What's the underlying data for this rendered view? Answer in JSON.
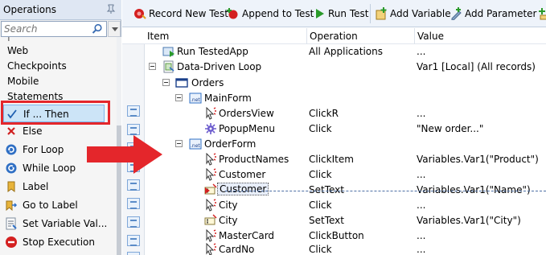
{
  "operations_panel": {
    "title": "Operations",
    "search_placeholder": "Search",
    "categories": [
      "Web",
      "Checkpoints",
      "Mobile",
      "Statements"
    ],
    "items": [
      {
        "label": "If ... Then",
        "icon": "check-icon",
        "selected": true
      },
      {
        "label": "Else",
        "icon": "else-icon"
      },
      {
        "label": "For Loop",
        "icon": "for-loop-icon"
      },
      {
        "label": "While Loop",
        "icon": "while-loop-icon"
      },
      {
        "label": "Label",
        "icon": "label-icon"
      },
      {
        "label": "Go to Label",
        "icon": "go-to-label-icon"
      },
      {
        "label": "Set Variable Val...",
        "icon": "set-variable-icon"
      },
      {
        "label": "Stop Execution",
        "icon": "stop-icon"
      }
    ]
  },
  "toolbar": {
    "record_new_test": "Record New Test",
    "append_to_test": "Append to Test",
    "run_test": "Run Test",
    "add_variable": "Add Variable",
    "add_parameter": "Add Parameter"
  },
  "grid": {
    "columns": {
      "item": "Item",
      "operation": "Operation",
      "value": "Value"
    },
    "rows": [
      {
        "item": "Run TestedApp",
        "operation": "All Applications",
        "value": "..."
      },
      {
        "item": "Data-Driven Loop",
        "operation": "",
        "value": "Var1 [Local] (All records)"
      },
      {
        "item": "Orders",
        "operation": "",
        "value": ""
      },
      {
        "item": "MainForm",
        "operation": "",
        "value": ""
      },
      {
        "item": "OrdersView",
        "operation": "ClickR",
        "value": "..."
      },
      {
        "item": "PopupMenu",
        "operation": "Click",
        "value": "\"New order...\""
      },
      {
        "item": "OrderForm",
        "operation": "",
        "value": ""
      },
      {
        "item": "ProductNames",
        "operation": "ClickItem",
        "value": "Variables.Var1(\"Product\")"
      },
      {
        "item": "Customer",
        "operation": "Click",
        "value": "..."
      },
      {
        "item": "Customer",
        "operation": "SetText",
        "value": "Variables.Var1(\"Name\")"
      },
      {
        "item": "City",
        "operation": "Click",
        "value": "..."
      },
      {
        "item": "City",
        "operation": "SetText",
        "value": "Variables.Var1(\"City\")"
      },
      {
        "item": "MasterCard",
        "operation": "ClickButton",
        "value": "..."
      },
      {
        "item": "CardNo",
        "operation": "Click",
        "value": "..."
      }
    ]
  },
  "colors": {
    "highlight_box": "#e4262b",
    "drag_arrow": "#e4262b",
    "selection": "#cce4f7"
  }
}
